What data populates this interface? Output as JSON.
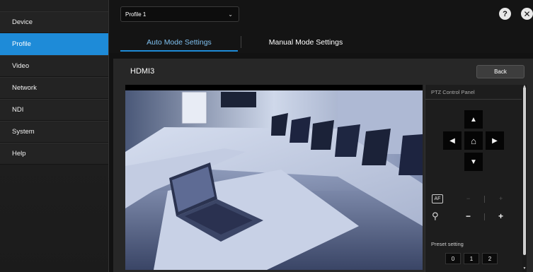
{
  "sidebar": {
    "items": [
      {
        "label": "Device",
        "active": false
      },
      {
        "label": "Profile",
        "active": true
      },
      {
        "label": "Video",
        "active": false
      },
      {
        "label": "Network",
        "active": false
      },
      {
        "label": "NDI",
        "active": false
      },
      {
        "label": "System",
        "active": false
      },
      {
        "label": "Help",
        "active": false
      }
    ]
  },
  "header": {
    "profile_select": {
      "value": "Profile 1"
    },
    "help_icon": "?",
    "close_icon": "✕",
    "tabs": [
      {
        "label": "Auto Mode Settings",
        "active": true
      },
      {
        "label": "Manual Mode Settings",
        "active": false
      }
    ]
  },
  "main": {
    "title": "HDMI3",
    "back_label": "Back",
    "ptz": {
      "title": "PTZ Control Panel",
      "focus_icon": "AF",
      "zoom_minus": "−",
      "zoom_plus": "+",
      "preset_label": "Preset setting",
      "presets": [
        "0",
        "1",
        "2"
      ]
    }
  },
  "colors": {
    "accent": "#1e8bd8",
    "background": "#121212",
    "panel": "#272727"
  }
}
